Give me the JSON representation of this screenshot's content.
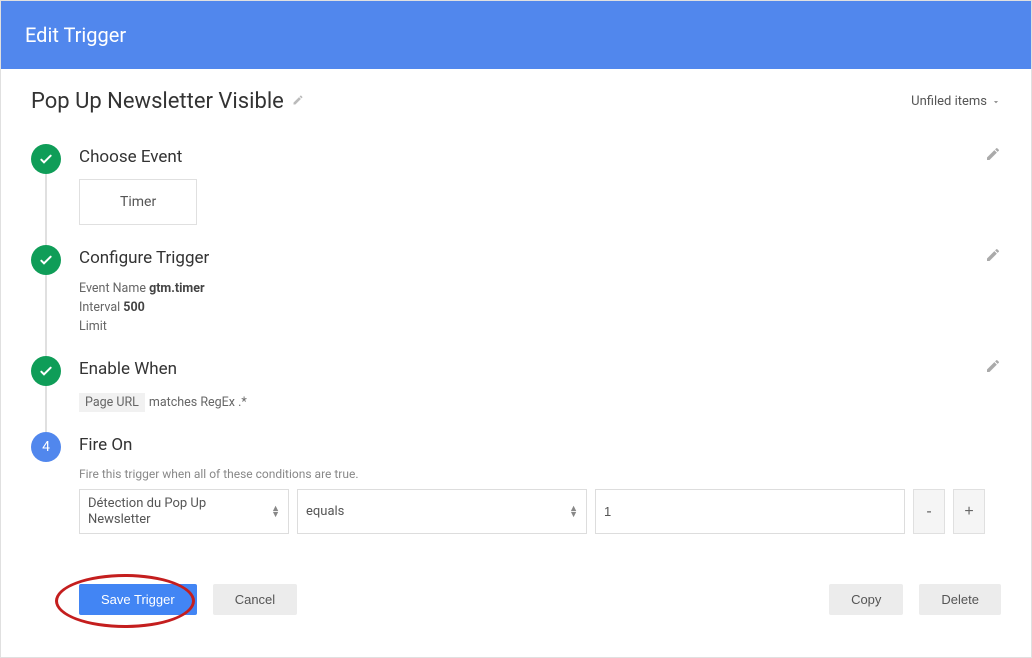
{
  "header": {
    "title": "Edit Trigger"
  },
  "unfiled": "Unfiled items",
  "trigger_name": "Pop Up Newsletter Visible",
  "steps": {
    "choose_event": {
      "title": "Choose Event",
      "value": "Timer"
    },
    "configure": {
      "title": "Configure Trigger",
      "event_name_label": "Event Name",
      "event_name_value": "gtm.timer",
      "interval_label": "Interval",
      "interval_value": "500",
      "limit_label": "Limit"
    },
    "enable_when": {
      "title": "Enable When",
      "var": "Page URL",
      "rest": "matches RegEx .*"
    },
    "fire_on": {
      "number": "4",
      "title": "Fire On",
      "hint": "Fire this trigger when all of these conditions are true.",
      "variable": "Détection du Pop Up Newsletter",
      "operator": "equals",
      "value": "1"
    }
  },
  "buttons": {
    "save": "Save Trigger",
    "cancel": "Cancel",
    "copy": "Copy",
    "delete": "Delete",
    "minus": "-",
    "plus": "+"
  }
}
